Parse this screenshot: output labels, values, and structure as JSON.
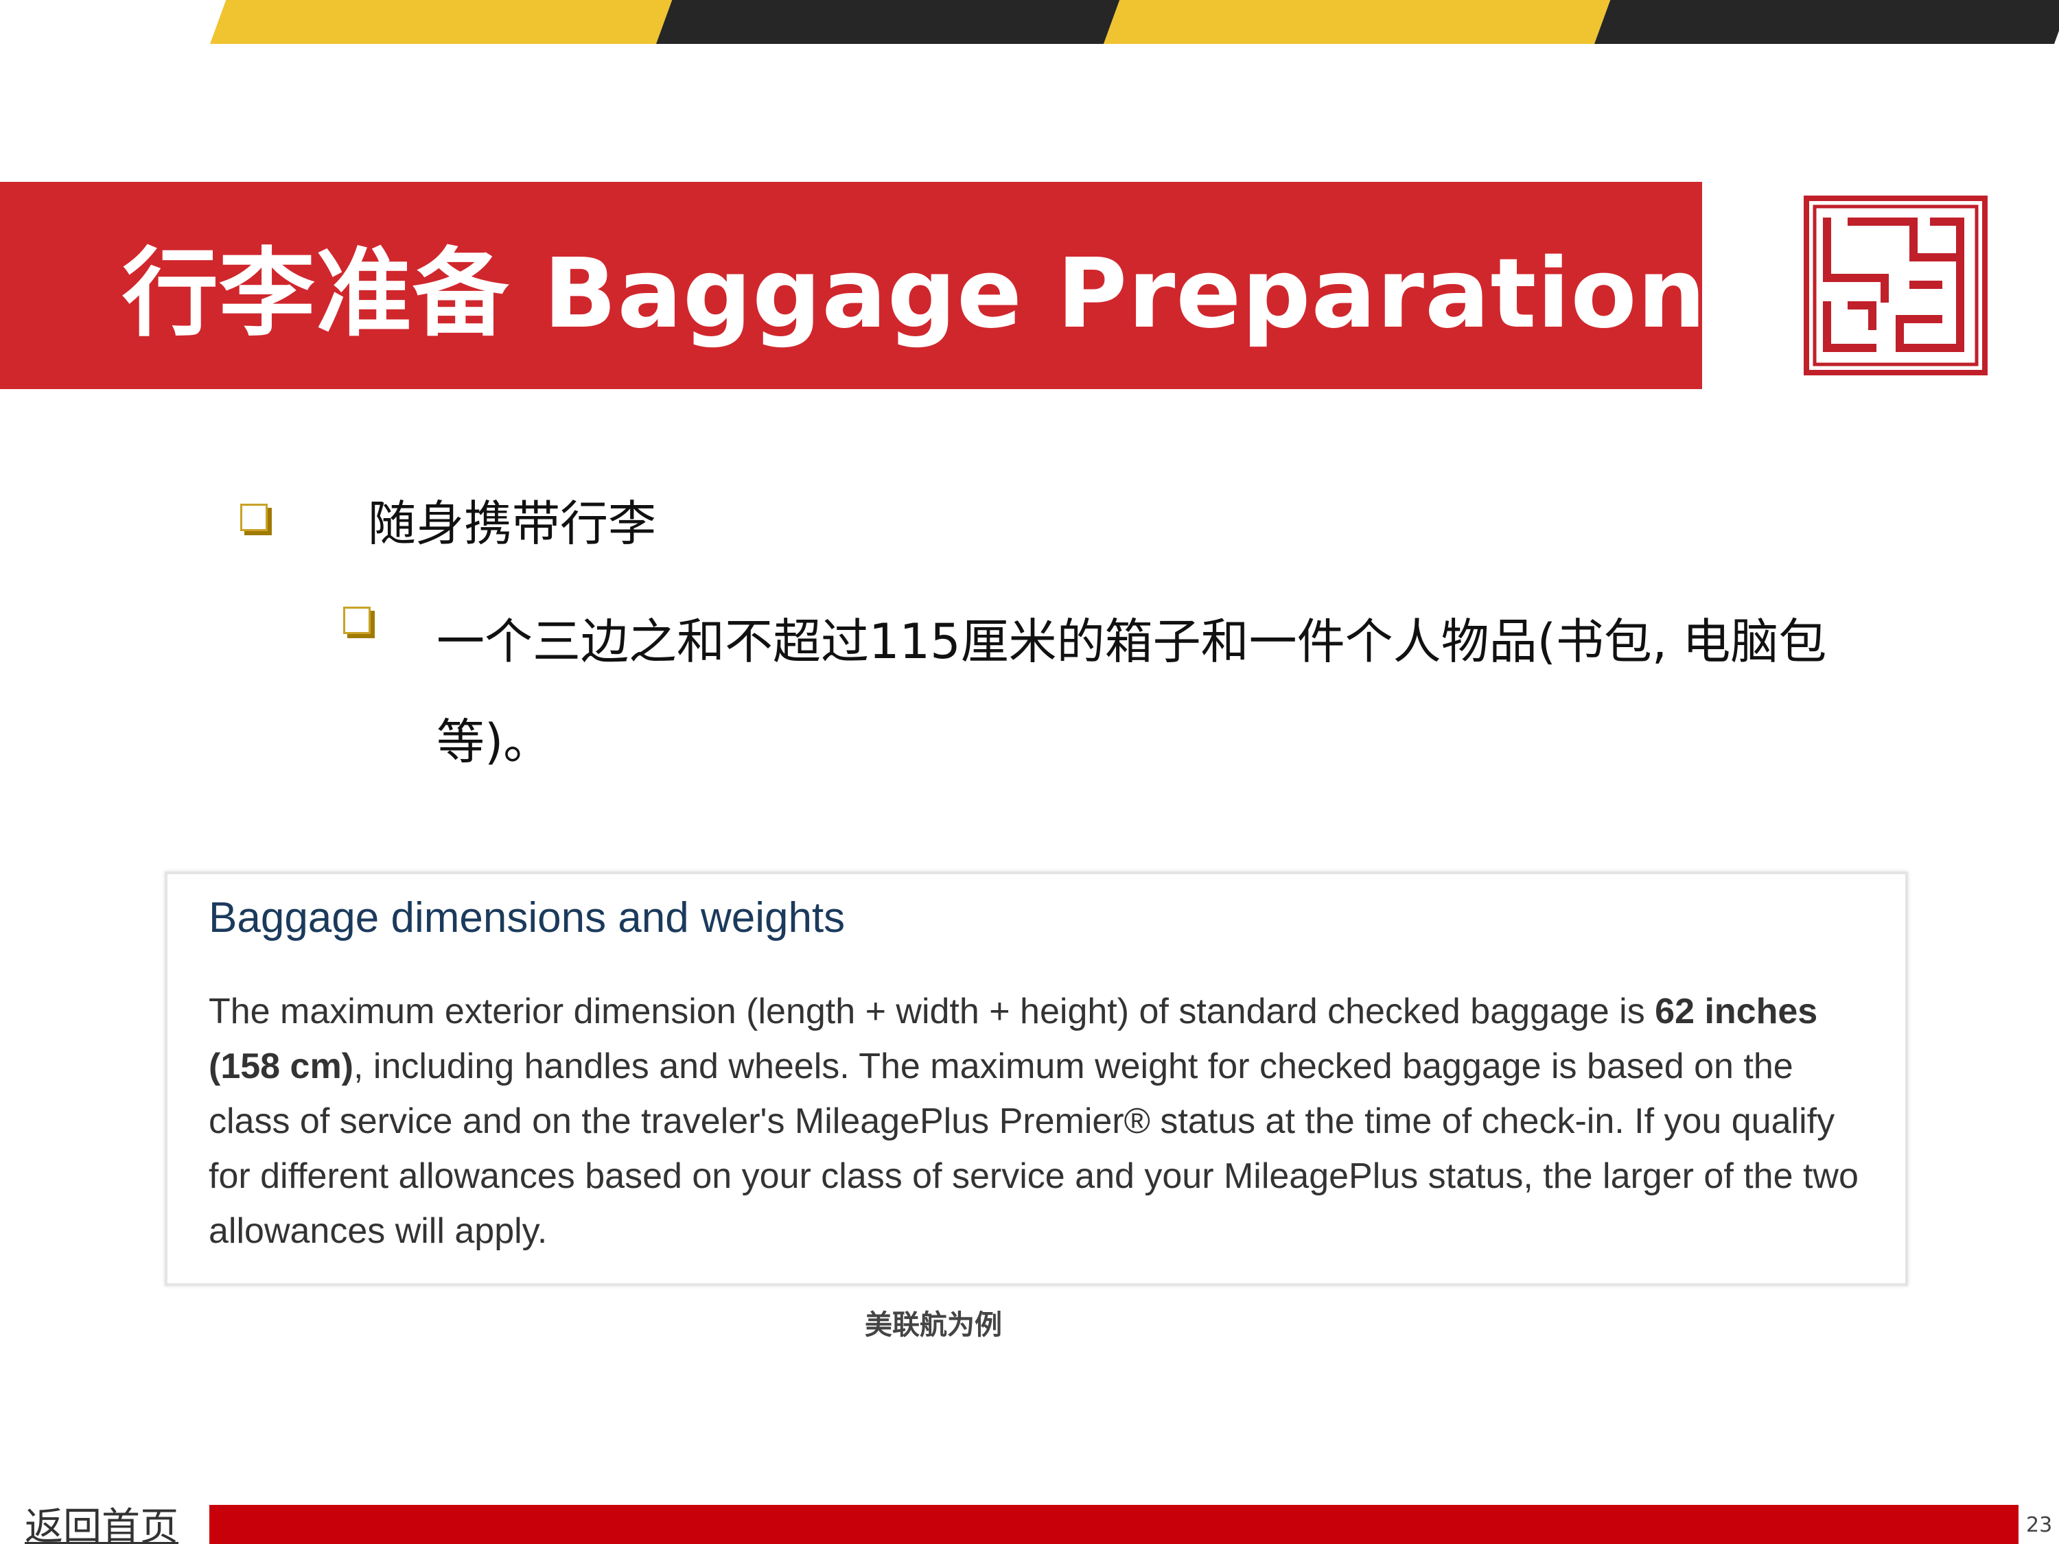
{
  "header": {
    "title": "行李准备 Baggage Preparation",
    "colors": {
      "banner": "#D0272D",
      "stripe_yellow": "#F0C330",
      "stripe_dark": "#262626"
    }
  },
  "logo": {
    "icon": "red-seal-logo-icon",
    "color": "#C0202A"
  },
  "bullets": {
    "level1": "随身携带行李",
    "level2": "一个三边之和不超过115厘米的箱子和一件个人物品(书包, 电脑包等)。"
  },
  "screenshot": {
    "title": "Baggage dimensions and weights",
    "body_prefix": "The maximum exterior dimension (length + width + height) of standard checked baggage is ",
    "body_bold": "62 inches (158 cm)",
    "body_suffix": ", including handles and wheels. The maximum weight for checked baggage is based on the class of service and on the traveler's MileagePlus Premier® status at the time of check-in. If you qualify for different allowances based on your class of service and your MileagePlus status, the larger of the two allowances will apply."
  },
  "caption": "美联航为例",
  "footer": {
    "home_link": "返回首页",
    "page_number": "23",
    "bar_color": "#C8000A"
  }
}
